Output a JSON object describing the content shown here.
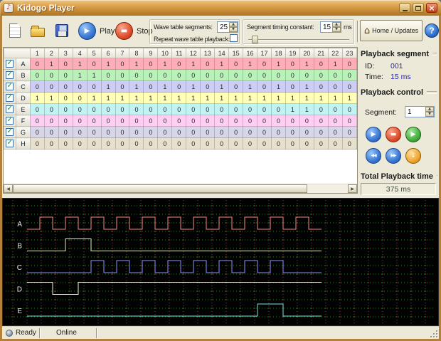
{
  "window": {
    "title": "Kidogo Player"
  },
  "icons": {
    "app": "♪",
    "close": "×",
    "play": "▶",
    "stop": "▬",
    "rewind": "◀◀",
    "forward": "▶▶",
    "down": "↓",
    "help": "?",
    "home": "⌂",
    "check": "✓",
    "spin_up": "▲",
    "spin_down": "▼",
    "scroll_left": "◀",
    "scroll_right": "▶"
  },
  "toolbar": {
    "play": "Play",
    "stop": "Stop",
    "home": "Home / Updates",
    "groups": {
      "wave_segments_label": "Wave table segments:",
      "wave_segments_value": "25",
      "repeat_label": "Repeat wave table playback:",
      "timing_label": "Segment timing constant:",
      "timing_value": "15",
      "timing_unit": "ms"
    }
  },
  "grid": {
    "columns": [
      "1",
      "2",
      "3",
      "4",
      "5",
      "6",
      "7",
      "8",
      "9",
      "10",
      "11",
      "12",
      "13",
      "14",
      "15",
      "16",
      "17",
      "18",
      "19",
      "20",
      "21",
      "22",
      "23"
    ],
    "rows": [
      {
        "label": "A",
        "checked": true,
        "bg": "#ffadb9",
        "trace": "#ff8484",
        "values": [
          0,
          1,
          0,
          1,
          0,
          1,
          0,
          1,
          0,
          1,
          0,
          1,
          0,
          1,
          0,
          1,
          0,
          1,
          0,
          1,
          0,
          1,
          0
        ]
      },
      {
        "label": "B",
        "checked": true,
        "bg": "#b9f2b9",
        "trace": "#e3e6c2",
        "values": [
          0,
          0,
          0,
          1,
          1,
          0,
          0,
          0,
          0,
          0,
          0,
          0,
          0,
          0,
          0,
          0,
          0,
          0,
          0,
          0,
          0,
          0,
          0
        ]
      },
      {
        "label": "C",
        "checked": true,
        "bg": "#cdcdf6",
        "trace": "#9191ff",
        "values": [
          0,
          0,
          0,
          0,
          0,
          1,
          0,
          1,
          0,
          1,
          0,
          1,
          0,
          1,
          0,
          1,
          0,
          1,
          0,
          1,
          0,
          0,
          0
        ]
      },
      {
        "label": "D",
        "checked": true,
        "bg": "#ffffb5",
        "trace": "#f2f2df",
        "values": [
          1,
          1,
          0,
          0,
          1,
          1,
          1,
          1,
          1,
          1,
          1,
          1,
          1,
          1,
          1,
          1,
          1,
          1,
          1,
          1,
          1,
          1,
          1
        ]
      },
      {
        "label": "E",
        "checked": true,
        "bg": "#c2f3f3",
        "trace": "#7fe3e3",
        "values": [
          0,
          0,
          0,
          0,
          0,
          0,
          0,
          0,
          0,
          0,
          0,
          0,
          0,
          0,
          0,
          0,
          0,
          0,
          1,
          1,
          0,
          0,
          0
        ]
      },
      {
        "label": "F",
        "checked": true,
        "bg": "#ffcef2",
        "trace": "#ffb9e8",
        "values": [
          0,
          0,
          0,
          0,
          0,
          0,
          0,
          0,
          0,
          0,
          0,
          0,
          0,
          0,
          0,
          0,
          0,
          0,
          0,
          0,
          0,
          0,
          0
        ]
      },
      {
        "label": "G",
        "checked": true,
        "bg": "#d6d6e8",
        "trace": "#c4c4de",
        "values": [
          0,
          0,
          0,
          0,
          0,
          0,
          0,
          0,
          0,
          0,
          0,
          0,
          0,
          0,
          0,
          0,
          0,
          0,
          0,
          0,
          0,
          0,
          0
        ]
      },
      {
        "label": "H",
        "checked": true,
        "bg": "#e7e0cd",
        "trace": "#ded4ba",
        "values": [
          0,
          0,
          0,
          0,
          0,
          0,
          0,
          0,
          0,
          0,
          0,
          0,
          0,
          0,
          0,
          0,
          0,
          0,
          0,
          0,
          0,
          0,
          0
        ]
      }
    ]
  },
  "panel": {
    "segment_section": {
      "title": "Playback segment",
      "id_label": "ID:",
      "id_value": "001",
      "time_label": "Time:",
      "time_value": "15 ms"
    },
    "control_section": {
      "title": "Playback control",
      "segment_label": "Segment:",
      "segment_value": "1"
    },
    "total_section": {
      "title": "Total Playback time",
      "value": "375 ms"
    }
  },
  "scope": {
    "channels": [
      "A",
      "B",
      "C",
      "D",
      "E"
    ],
    "grid_color": "#1d7a1d",
    "dot_color": "#b03a28",
    "label_color": "#e8e8e8"
  },
  "status": {
    "ready": "Ready",
    "online": "Online"
  }
}
